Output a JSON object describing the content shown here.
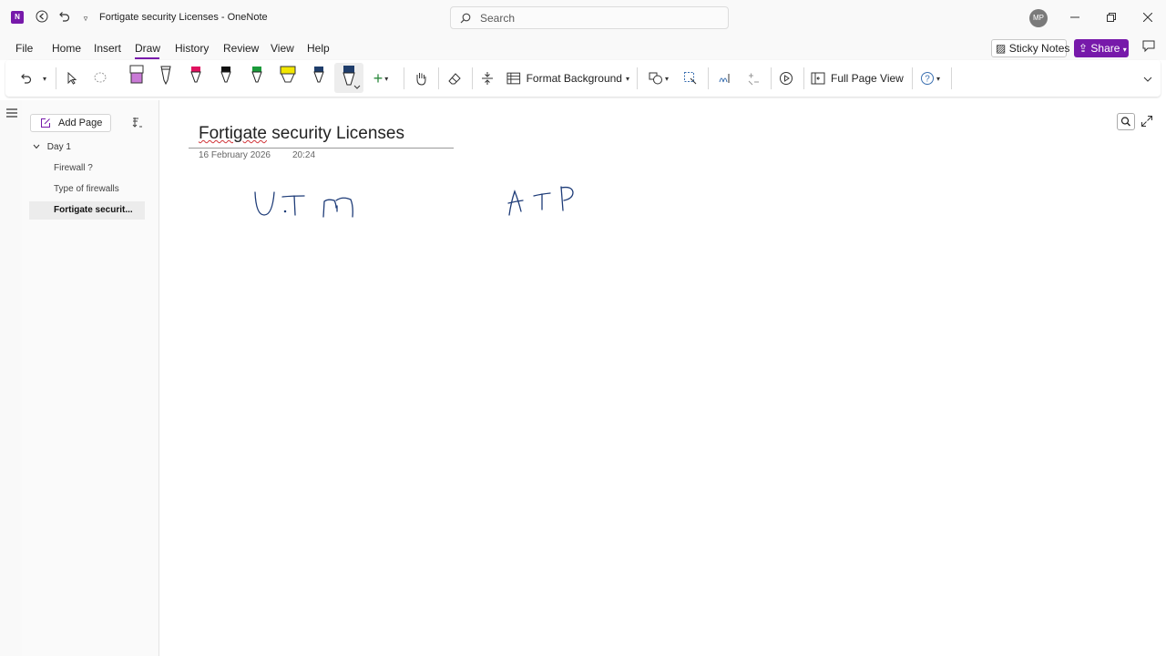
{
  "app": {
    "window_title": "Fortigate security Licenses - OneNote",
    "logo_text": "N",
    "avatar_initials": "MP",
    "search_placeholder": "Search"
  },
  "menu": {
    "items": [
      "File",
      "Home",
      "Insert",
      "Draw",
      "History",
      "Review",
      "View",
      "Help"
    ],
    "active": "Draw",
    "sticky_notes": "Sticky Notes",
    "share": "Share"
  },
  "ribbon": {
    "format_background": "Format Background",
    "full_page_view": "Full Page View",
    "pen_colors": [
      "#c97ad6",
      "#222222",
      "#e0115f",
      "#111111",
      "#1a9a3a",
      "#f2e600",
      "#1f3d6b",
      "#1f3d6b"
    ],
    "accent": "#7719aa"
  },
  "navigation": {
    "add_page": "Add Page",
    "section": "Day 1",
    "pages": [
      "Firewall ?",
      "Type of firewalls",
      "Fortigate securit..."
    ],
    "selected_page_index": 2
  },
  "page": {
    "title": "Fortigate security Licenses",
    "title_misspelled_word": "Fortigate",
    "title_rest": " security Licenses",
    "date": "16 February 2026",
    "time": "20:24",
    "ink_color": "#1e3c78"
  }
}
